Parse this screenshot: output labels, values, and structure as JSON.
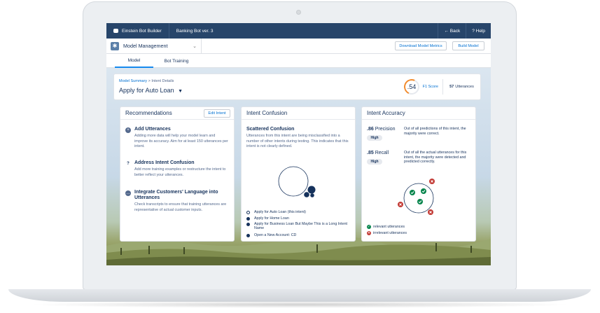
{
  "topbar": {
    "app_name": "Einstein Bot Builder",
    "bot_name": "Banking Bot ver. 3",
    "back_label": "← Back",
    "help_label": "? Help"
  },
  "header": {
    "section": "Model Management",
    "download_label": "Download Model Metrics",
    "build_label": "Build Model"
  },
  "tabs": [
    {
      "label": "Model"
    },
    {
      "label": "Bot Training"
    }
  ],
  "intent": {
    "breadcrumb_link": "Model Summary",
    "breadcrumb_sep": ">",
    "breadcrumb_current": "Intent Details",
    "title": "Apply for Auto Loan",
    "f1_score": ".54",
    "f1_label": "F1 Score",
    "utterance_count": "57",
    "utterance_label": "Utterances"
  },
  "recommendations": {
    "title": "Recommendations",
    "edit_label": "Edit Intent",
    "items": [
      {
        "title": "Add Utterances",
        "body": "Adding more data will help your model learn and improve its accuracy. Aim for at least 150 utterances per intent.",
        "icon": "plus-icon"
      },
      {
        "title": "Address Intent Confusion",
        "body": "Add more training examples or restructure the intent to better reflect your utterances.",
        "icon": "question-icon"
      },
      {
        "title": "Integrate Customers' Language into Utterances",
        "body": "Check transcripts to ensure that training utterances are representative of actual customer inputs.",
        "icon": "chat-icon"
      }
    ]
  },
  "confusion": {
    "title": "Intent Confusion",
    "subtitle": "Scattered Confusion",
    "body": "Utterances from this intent are being misclassified into a number of other intents during testing. This indicates that this intent is not clearly defined.",
    "legend": [
      {
        "label": "Apply for Auto Loan (this intent)",
        "color": "#ffffff"
      },
      {
        "label": "Apply for Home Loan",
        "color": "#16325c"
      },
      {
        "label": "Apply for Business Loan But Maybe This is a Long Intent Name",
        "color": "#16325c"
      },
      {
        "label": "Open a New Account: CD",
        "color": "#16325c"
      }
    ]
  },
  "accuracy": {
    "title": "Intent Accuracy",
    "precision_value": ".86",
    "precision_label": "Precision",
    "precision_badge": "High",
    "precision_desc": "Out of all predictions of this intent, the majority were correct.",
    "recall_value": ".85",
    "recall_label": "Recall",
    "recall_badge": "High",
    "recall_desc": "Out of all the actual utterances for this intent, the majority were detected and predicted correctly.",
    "relevant_label": "relevant utterances",
    "irrelevant_label": "irrelevant utterances",
    "relevant_color": "#04844b",
    "irrelevant_color": "#c23934"
  }
}
